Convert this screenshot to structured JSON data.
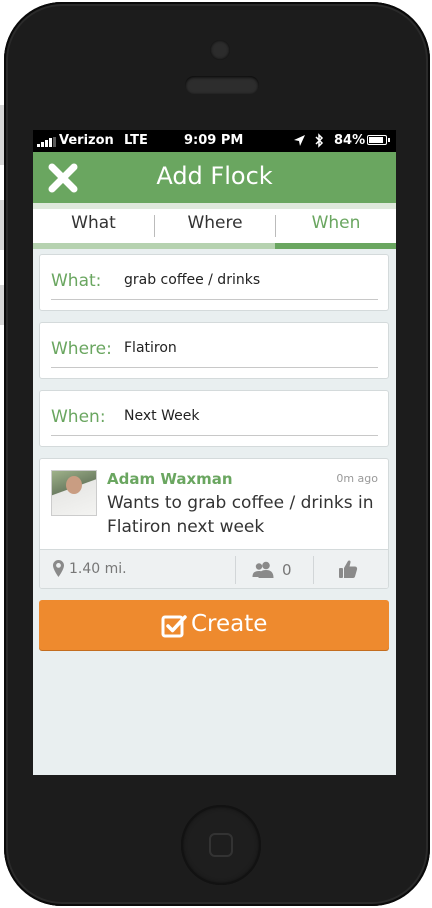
{
  "status_bar": {
    "carrier": "Verizon",
    "network": "LTE",
    "time": "9:09 PM",
    "battery": "84%"
  },
  "header": {
    "title": "Add Flock",
    "close_icon": "close-icon"
  },
  "tabs": [
    {
      "label": "What"
    },
    {
      "label": "Where"
    },
    {
      "label": "When",
      "active": true
    }
  ],
  "fields": {
    "what": {
      "label": "What:",
      "value": "grab coffee / drinks"
    },
    "where": {
      "label": "Where:",
      "value": "Flatiron"
    },
    "when": {
      "label": "When:",
      "value": "Next Week"
    }
  },
  "preview": {
    "name": "Adam Waxman",
    "time": "0m ago",
    "text": "Wants to grab coffee / drinks  in Flatiron next week",
    "distance": "1.40 mi.",
    "attendees": "0"
  },
  "create_button": {
    "label": "Create"
  },
  "colors": {
    "accent_green": "#6aa660",
    "create_orange": "#ee8a2e",
    "screen_bg": "#e9eff0"
  }
}
